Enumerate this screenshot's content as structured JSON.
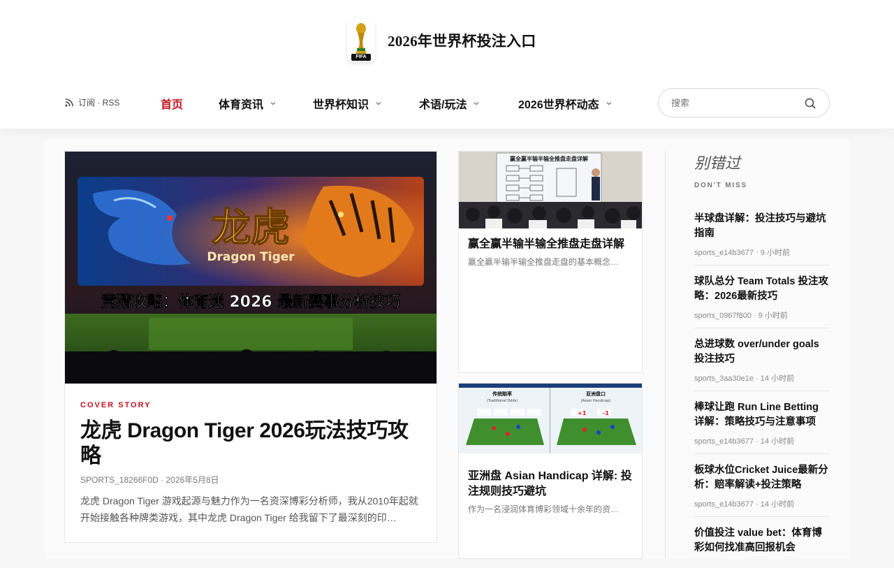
{
  "site": {
    "title": "2026年世界杯投注入口",
    "logo_text": "FIFA"
  },
  "nav": {
    "rss_label": "订阅 · RSS",
    "items": [
      {
        "label": "首页"
      },
      {
        "label": "体育资讯"
      },
      {
        "label": "世界杯知识"
      },
      {
        "label": "术语/玩法"
      },
      {
        "label": "2026世界杯动态"
      }
    ],
    "search_placeholder": "搜索"
  },
  "cover": {
    "image_title": "龙虎",
    "image_subtitle": "Dragon Tiger",
    "image_banner": "竞猜攻略：体育迷 2026 最新赛事分析技巧",
    "tag": "COVER STORY",
    "title": "龙虎 Dragon Tiger 2026玩法技巧攻略",
    "meta": "SPORTS_18266F0D · 2026年5月8日",
    "excerpt": "龙虎 Dragon Tiger 游戏起源与魅力作为一名资深博彩分析师，我从2010年起就开始接触各种牌类游戏，其中龙虎 Dragon Tiger 给我留下了最深刻的印…"
  },
  "cards": [
    {
      "image_heading": "赢全赢半输半输全推盘走盘详解",
      "title": "赢全赢半输半输全推盘走盘详解",
      "excerpt": "赢全赢半输半输全推盘走盘的基本概念…"
    },
    {
      "image_left_label": "传统赔率",
      "image_left_sub": "(Traditional Odds)",
      "image_right_label": "亚洲盘口",
      "image_right_sub": "(Asian Handicap)",
      "title": "亚洲盘 Asian Handicap 详解: 投注规则技巧避坑",
      "excerpt": "作为一名浸润体育博彩领域十余年的资…"
    }
  ],
  "sidebar": {
    "title": "别错过",
    "subtitle": "DON'T MISS",
    "items": [
      {
        "title": "半球盘详解：投注技巧与避坑指南",
        "meta": "sports_e14b3677 · 9 小时前"
      },
      {
        "title": "球队总分 Team Totals 投注攻略：2026最新技巧",
        "meta": "sports_0967f800 · 9 小时前"
      },
      {
        "title": "总进球数 over/under goals 投注技巧",
        "meta": "sports_3aa30e1e · 14 小时前"
      },
      {
        "title": "棒球让跑 Run Line Betting 详解：策略技巧与注意事项",
        "meta": "sports_e14b3677 · 14 小时前"
      },
      {
        "title": "板球水位Cricket Juice最新分析：赔率解读+投注策略",
        "meta": "sports_e14b3677 · 14 小时前"
      },
      {
        "title": "价值投注 value bet：体育博彩如何找准高回报机会",
        "meta": ""
      }
    ]
  },
  "colors": {
    "accent": "#c1121f",
    "text": "#111111",
    "muted": "#777777"
  }
}
